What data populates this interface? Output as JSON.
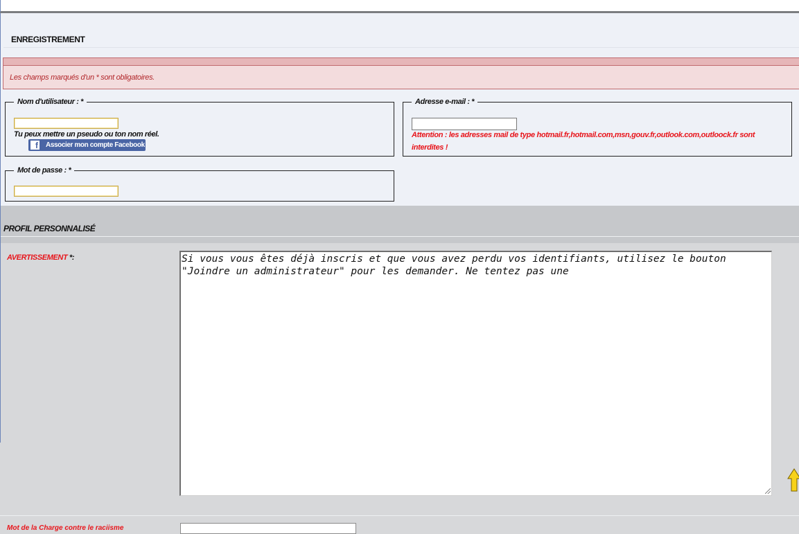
{
  "registration": {
    "title": "ENREGISTREMENT",
    "required_notice": "Les champs marqués d'un * sont obligatoires.",
    "username": {
      "legend": "Nom d'utilisateur : *",
      "value": "",
      "hint": "Tu peux mettre un pseudo ou ton nom réel.",
      "facebook_button": "Associer mon compte Facebook"
    },
    "email": {
      "legend": "Adresse e-mail : *",
      "value": "",
      "warning": "Attention : les adresses mail de type hotmail.fr,hotmail.com,msn,gouv.fr,outlook.com,outloock.fr sont interdites !"
    },
    "password": {
      "legend": "Mot de passe : *",
      "value": ""
    }
  },
  "profile": {
    "title": "PROFIL PERSONNALISÉ",
    "avertissement": {
      "label": "AVERTISSEMENT",
      "required_mark": " *:",
      "text": "Si vous vous êtes déjà inscris et que vous avez perdu vos identifiants, utilisez le bouton \"Joindre un administrateur\" pour les demander. Ne tentez pas une"
    },
    "next_field": {
      "label": "Mot de la Charge contre le raciisme",
      "value": ""
    }
  },
  "icons": {
    "facebook": "facebook-f-icon",
    "scroll_top": "up-arrow-icon"
  },
  "colors": {
    "error_red": "#e8141a",
    "notice_red": "#b2272b",
    "facebook_blue": "#4a65a5",
    "panel_bg": "#eef1f7"
  }
}
